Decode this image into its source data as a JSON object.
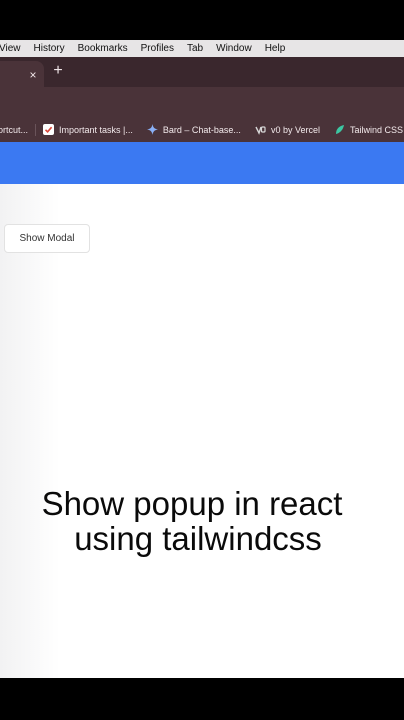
{
  "menubar": [
    "View",
    "History",
    "Bookmarks",
    "Profiles",
    "Tab",
    "Window",
    "Help"
  ],
  "tabs": {
    "close_glyph": "×",
    "new_tab_glyph": "+"
  },
  "bookmarks": [
    {
      "label": "ortcut...",
      "icon": "none"
    },
    {
      "label": "Important tasks |...",
      "icon": "tasks-icon"
    },
    {
      "label": "Bard – Chat-base...",
      "icon": "bard-sparkle-icon"
    },
    {
      "label": "v0 by Vercel",
      "icon": "v0-icon"
    },
    {
      "label": "Tailwind CSS",
      "icon": "tailwind-icon"
    }
  ],
  "page": {
    "show_modal_label": "Show Modal"
  },
  "caption": {
    "line1": "Show popup in react",
    "line2": "using tailwindcss"
  },
  "colors": {
    "header": "#3b79f2",
    "tabstrip": "#3a272d",
    "toolbar": "#4a3339",
    "menubar": "#e7e5e6"
  }
}
